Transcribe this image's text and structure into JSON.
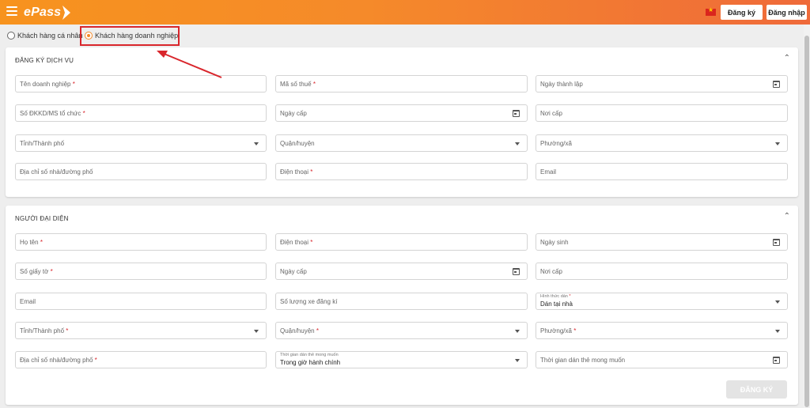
{
  "header": {
    "logo_text": "ePass",
    "register_label": "Đăng ký",
    "login_label": "Đăng nhập"
  },
  "customer_type": {
    "personal_label": "Khách hàng cá nhân",
    "business_label": "Khách hàng doanh nghiệp",
    "selected": "business"
  },
  "section_service": {
    "title": "ĐĂNG KÝ DỊCH VỤ",
    "company_name": "Tên doanh nghiệp",
    "tax_code": "Mã số thuế",
    "founded_date": "Ngày thành lập",
    "business_reg_no": "Số ĐKKD/MS tổ chức",
    "issue_date": "Ngày cấp",
    "issue_place": "Nơi cấp",
    "province": "Tỉnh/Thành phố",
    "district": "Quận/huyện",
    "ward": "Phường/xã",
    "street_address": "Địa chỉ số nhà/đường phố",
    "phone": "Điện thoại",
    "email": "Email"
  },
  "section_rep": {
    "title": "NGƯỜI ĐẠI DIỆN",
    "full_name": "Họ tên",
    "phone": "Điện thoại",
    "birth_date": "Ngày sinh",
    "id_number": "Số giấy tờ",
    "issue_date": "Ngày cấp",
    "issue_place": "Nơi cấp",
    "email": "Email",
    "vehicle_count": "Số lượng xe đăng kí",
    "install_method_label": "Hình thức dán",
    "install_method_value": "Dán tại nhà",
    "province": "Tỉnh/Thành phố",
    "district": "Quận/huyện",
    "ward": "Phường/xã",
    "street_address": "Địa chỉ số nhà/đường phố",
    "desired_time_label": "Thời gian dán thẻ mong muốn",
    "desired_time_value": "Trong giờ hành chính",
    "desired_time_placeholder": "Thời gian dán thẻ mong muốn"
  },
  "submit_label": "ĐĂNG KÝ",
  "colors": {
    "brand_start": "#f7931e",
    "brand_end": "#ef6a3a",
    "required": "#d9262c",
    "annotation": "#d9262c"
  }
}
